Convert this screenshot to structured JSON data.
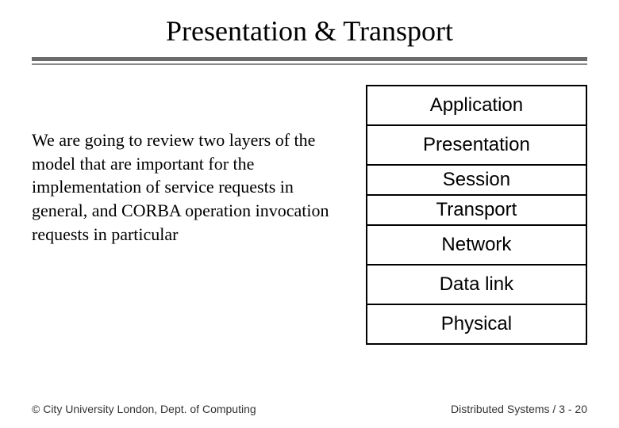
{
  "title": "Presentation & Transport",
  "body_text": "We are going to review two layers of the model that are important for the implementation of service requests in general, and CORBA operation invocation requests in particular",
  "layers": {
    "l1": "Application",
    "l2": "Presentation",
    "l3": "Session",
    "l4": "Transport",
    "l5": "Network",
    "l6": "Data link",
    "l7": "Physical"
  },
  "footer_left": "© City University London, Dept. of Computing",
  "footer_right": "Distributed Systems / 3 - 20"
}
